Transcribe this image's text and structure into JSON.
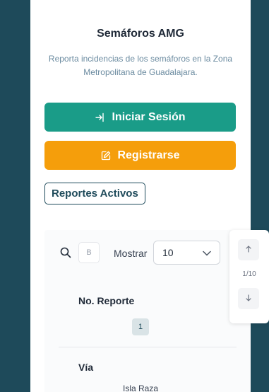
{
  "app": {
    "title": "Semáforos AMG",
    "subtitle": "Reporta incidencias de los semáforos en la Zona Metropolitana de Guadalajara."
  },
  "actions": {
    "login_label": "Iniciar Sesión",
    "register_label": "Registrarse"
  },
  "section": {
    "active_reports_label": "Reportes Activos"
  },
  "table": {
    "search_value": "B",
    "show_label": "Mostrar",
    "show_value": "10",
    "column_report": "No. Reporte",
    "row_number": "1",
    "column_via": "Vía",
    "via_value": "Isla Raza"
  },
  "pager": {
    "count": "1/10"
  },
  "colors": {
    "primary": "#1a9c88",
    "accent": "#f59e0b",
    "dark": "#1e4a5a"
  }
}
